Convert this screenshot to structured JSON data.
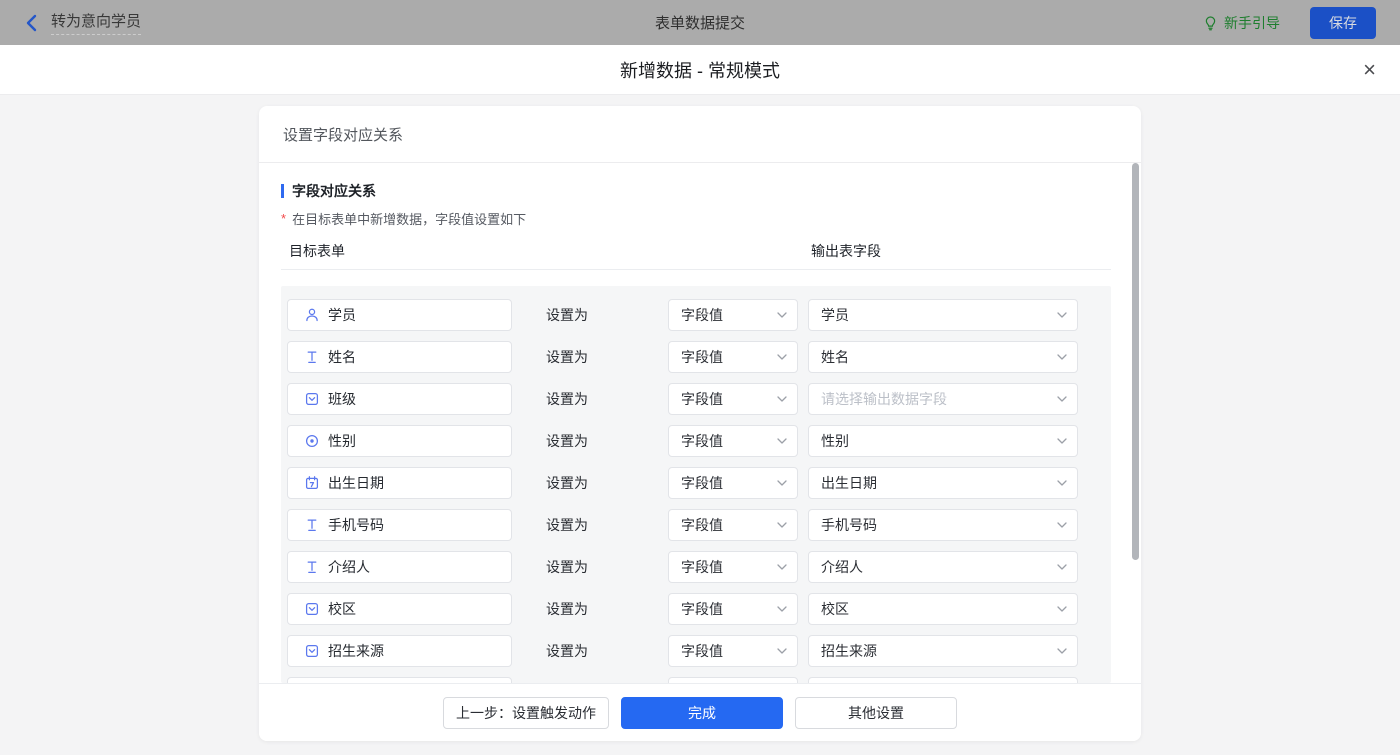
{
  "topbar": {
    "back_label": "转为意向学员",
    "title": "表单数据提交",
    "guide_label": "新手引导",
    "save_label": "保存"
  },
  "modal": {
    "title": "新增数据 - 常规模式",
    "close_glyph": "×"
  },
  "card": {
    "header_title": "设置字段对应关系",
    "section_title": "字段对应关系",
    "required_mark": "*",
    "subtitle": "在目标表单中新增数据，字段值设置如下",
    "columns": {
      "left": "目标表单",
      "right": "输出表字段"
    },
    "set_as_label": "设置为",
    "rows": [
      {
        "icon": "user",
        "field": "学员",
        "mode": "字段值",
        "output": "学员",
        "placeholder": false,
        "partial": false
      },
      {
        "icon": "text",
        "field": "姓名",
        "mode": "字段值",
        "output": "姓名",
        "placeholder": false,
        "partial": false
      },
      {
        "icon": "select",
        "field": "班级",
        "mode": "字段值",
        "output": "请选择输出数据字段",
        "placeholder": true,
        "partial": false
      },
      {
        "icon": "radio",
        "field": "性别",
        "mode": "字段值",
        "output": "性别",
        "placeholder": false,
        "partial": false
      },
      {
        "icon": "calendar",
        "field": "出生日期",
        "mode": "字段值",
        "output": "出生日期",
        "placeholder": false,
        "partial": false
      },
      {
        "icon": "text",
        "field": "手机号码",
        "mode": "字段值",
        "output": "手机号码",
        "placeholder": false,
        "partial": false
      },
      {
        "icon": "text",
        "field": "介绍人",
        "mode": "字段值",
        "output": "介绍人",
        "placeholder": false,
        "partial": false
      },
      {
        "icon": "select",
        "field": "校区",
        "mode": "字段值",
        "output": "校区",
        "placeholder": false,
        "partial": false
      },
      {
        "icon": "select",
        "field": "招生来源",
        "mode": "字段值",
        "output": "招生来源",
        "placeholder": false,
        "partial": false
      },
      {
        "icon": "none",
        "field": "",
        "mode": "",
        "output": "",
        "placeholder": false,
        "partial": true
      }
    ],
    "footer": {
      "prev_label": "上一步：设置触发动作",
      "done_label": "完成",
      "other_label": "其他设置"
    }
  },
  "colors": {
    "accent_blue": "#2569f2",
    "icon_blue": "#5b78ee",
    "guide_green": "#1e7e2e",
    "save_blue": "#1b50c6",
    "required_red": "#f2494a"
  }
}
